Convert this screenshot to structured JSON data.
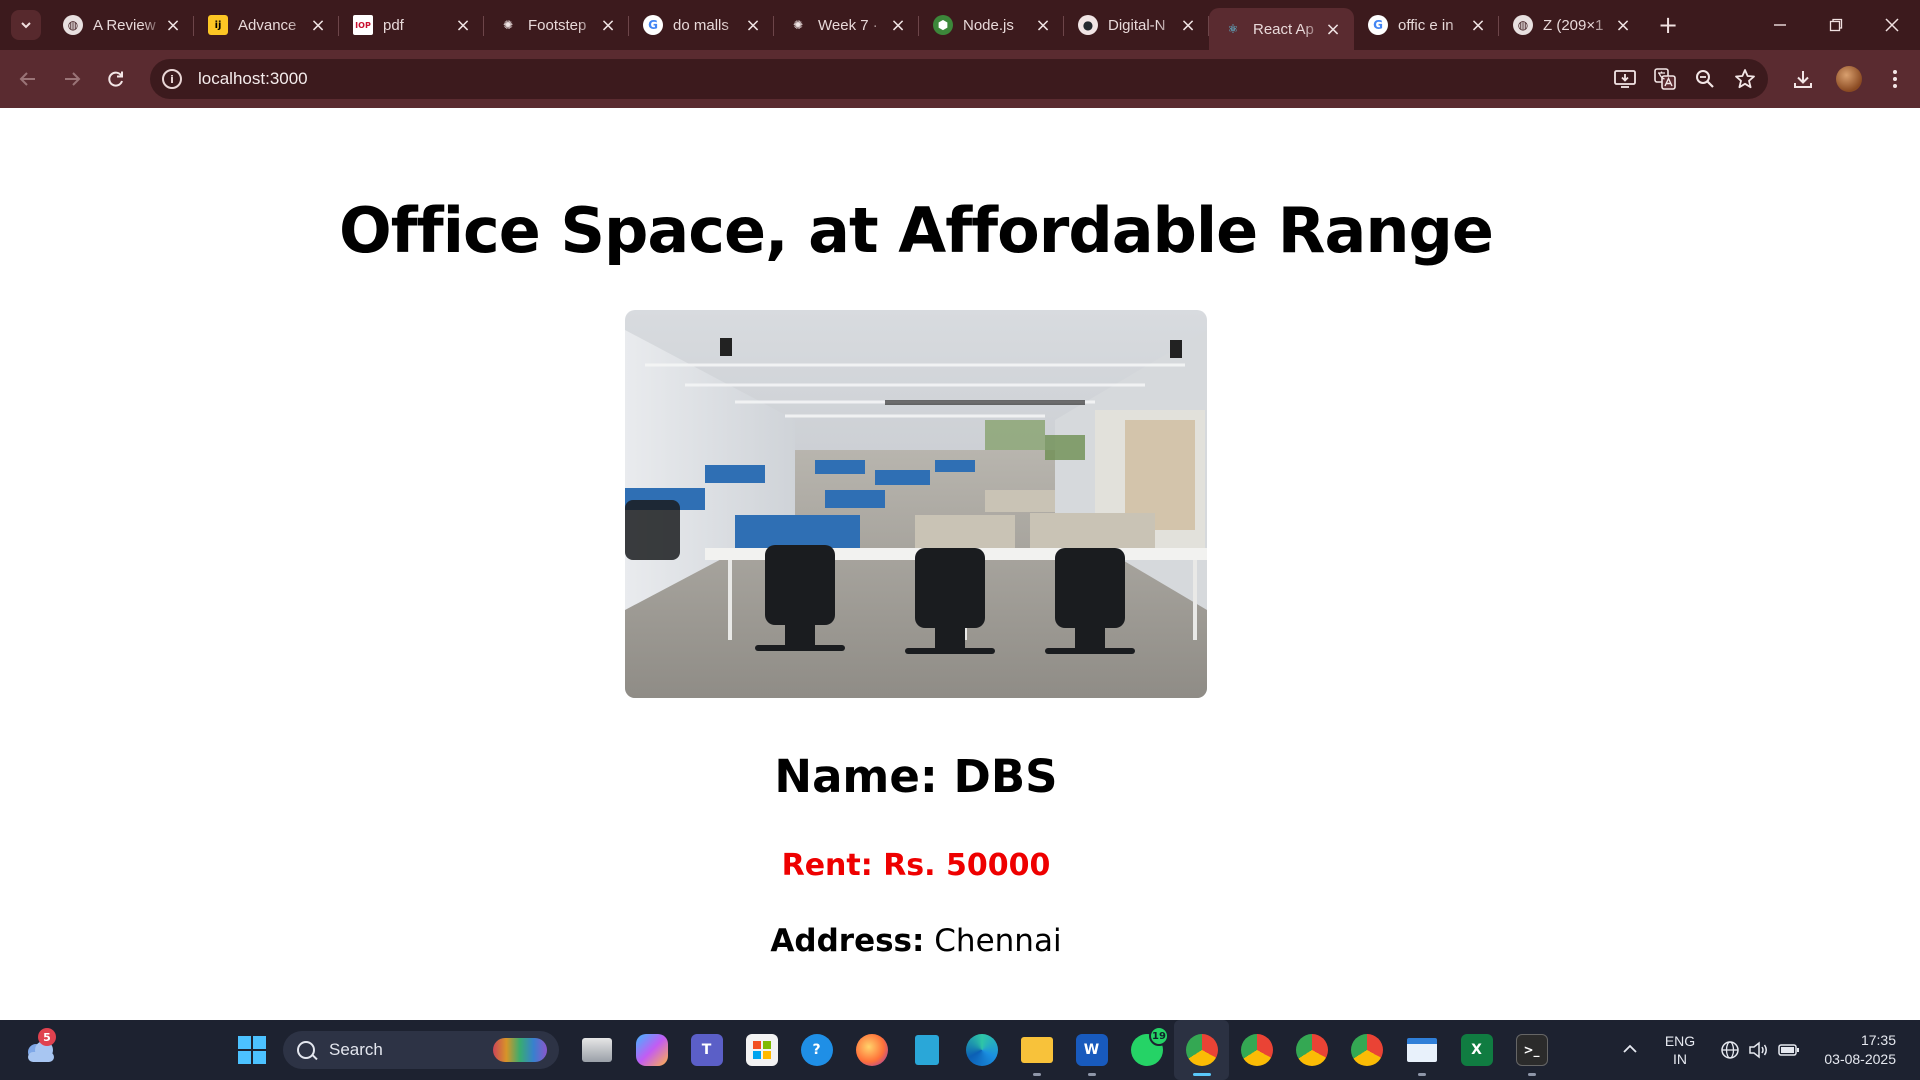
{
  "browser": {
    "tabs": [
      {
        "title": "A Review",
        "icon": "globe-icon",
        "active": false
      },
      {
        "title": "Advance",
        "icon": "intellij-icon",
        "active": false
      },
      {
        "title": "pdf",
        "icon": "iop-icon",
        "active": false
      },
      {
        "title": "Footstep",
        "icon": "chatgpt-icon",
        "active": false
      },
      {
        "title": "do malls",
        "icon": "google-icon",
        "active": false
      },
      {
        "title": "Week 7 ·",
        "icon": "chatgpt-icon",
        "active": false
      },
      {
        "title": "Node.js",
        "icon": "nodejs-icon",
        "active": false
      },
      {
        "title": "Digital-N",
        "icon": "github-icon",
        "active": false
      },
      {
        "title": "React Ap",
        "icon": "react-icon",
        "active": true
      },
      {
        "title": "offic e in",
        "icon": "google-icon",
        "active": false
      },
      {
        "title": "Z (209×1",
        "icon": "globe-icon",
        "active": false
      }
    ],
    "url": "localhost:3000"
  },
  "page": {
    "title": "Office Space, at Affordable Range",
    "name_text": "Name: DBS",
    "rent_text": "Rent: Rs. 50000",
    "address_label": "Address:",
    "address_value": "Chennai"
  },
  "taskbar": {
    "weather_badge": "5",
    "search_placeholder": "Search",
    "whatsapp_badge": "19",
    "lang_line1": "ENG",
    "lang_line2": "IN",
    "time": "17:35",
    "date": "03-08-2025"
  },
  "colors": {
    "tabstrip_bg": "#3c1a1d",
    "toolbar_bg": "#5a2b30",
    "rent_color": "#ee0000",
    "taskbar_bg": "#1d2230"
  }
}
